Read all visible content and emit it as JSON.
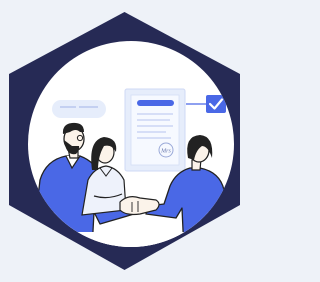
{
  "illustration": {
    "subject": "agreement-handshake",
    "signature_text": "Mrs",
    "colors": {
      "page_background": "#eef2f8",
      "badge": "#262a55",
      "badge_inner": "#ffffff",
      "accent": "#4a68e6",
      "accent_light": "#cad6fa",
      "document_panel": "#e6edfb",
      "skin": "#fbf3ea",
      "hair": "#222222",
      "outline": "#222222"
    },
    "icons": [
      "checkmark-icon",
      "speech-bubble-icon",
      "document-icon",
      "handshake-icon"
    ]
  }
}
